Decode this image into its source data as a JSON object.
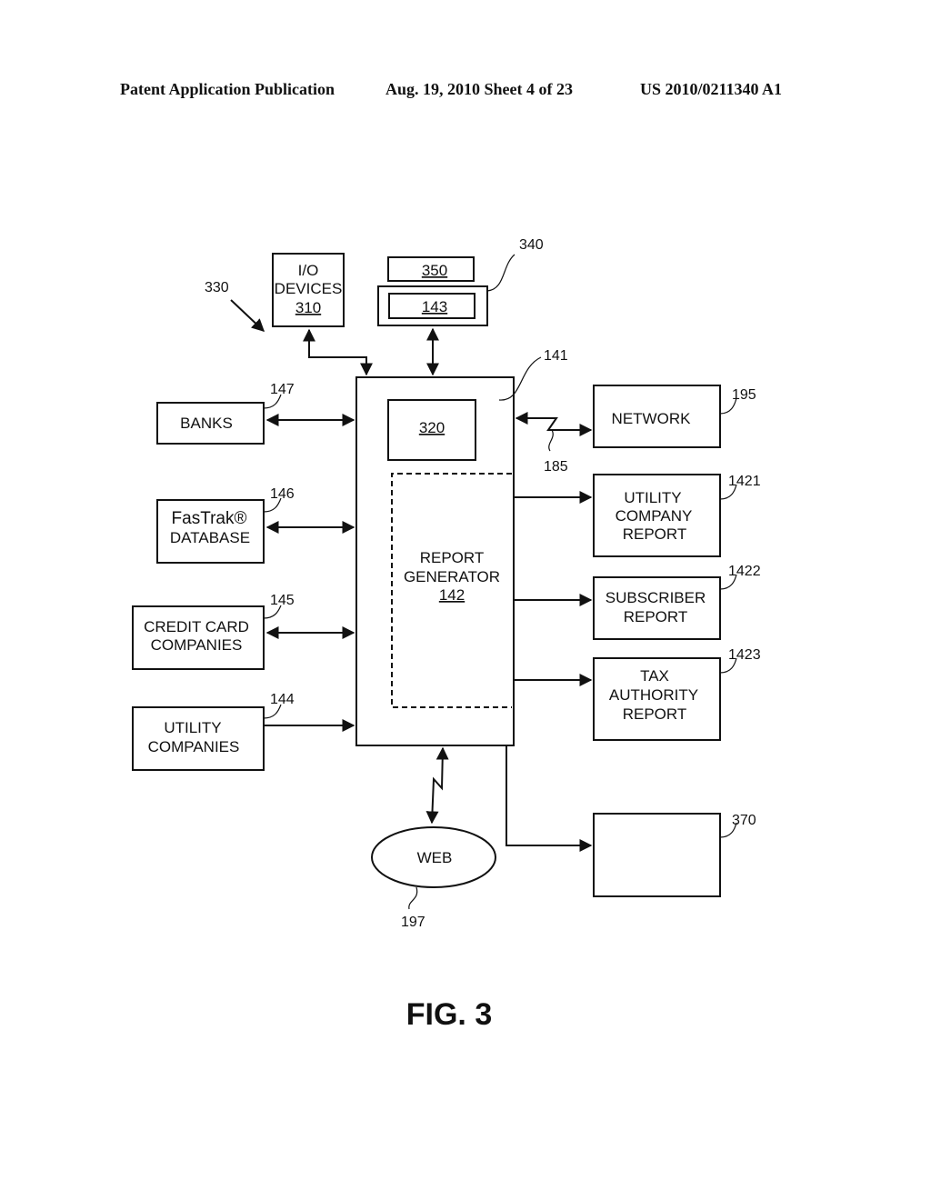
{
  "header": {
    "publication": "Patent Application Publication",
    "date_sheet": "Aug. 19, 2010  Sheet 4 of 23",
    "number": "US 2010/0211340 A1"
  },
  "figure": {
    "caption": "FIG. 3",
    "refs": {
      "system": "330",
      "storage_group": "340",
      "server": "141",
      "link_network": "185",
      "web": "197",
      "output_device": "370"
    },
    "io_devices": {
      "line1": "I/O",
      "line2": "DEVICES",
      "ref": "310"
    },
    "storage_350": {
      "ref": "350"
    },
    "storage_143": {
      "ref": "143"
    },
    "processor": {
      "ref": "320"
    },
    "report_generator": {
      "line1": "REPORT",
      "line2": "GENERATOR",
      "ref": "142"
    },
    "banks": {
      "label": "BANKS",
      "ref": "147"
    },
    "fastrak": {
      "line1": "FasTrak®",
      "line2": "DATABASE",
      "ref": "146"
    },
    "credit_card": {
      "line1": "CREDIT CARD",
      "line2": "COMPANIES",
      "ref": "145"
    },
    "utility_companies": {
      "line1": "UTILITY",
      "line2": "COMPANIES",
      "ref": "144"
    },
    "network": {
      "label": "NETWORK",
      "ref": "195"
    },
    "utility_report": {
      "line1": "UTILITY",
      "line2": "COMPANY",
      "line3": "REPORT",
      "ref": "1421"
    },
    "subscriber_report": {
      "line1": "SUBSCRIBER",
      "line2": "REPORT",
      "ref": "1422"
    },
    "tax_report": {
      "line1": "TAX",
      "line2": "AUTHORITY",
      "line3": "REPORT",
      "ref": "1423"
    },
    "web": {
      "label": "WEB"
    }
  }
}
